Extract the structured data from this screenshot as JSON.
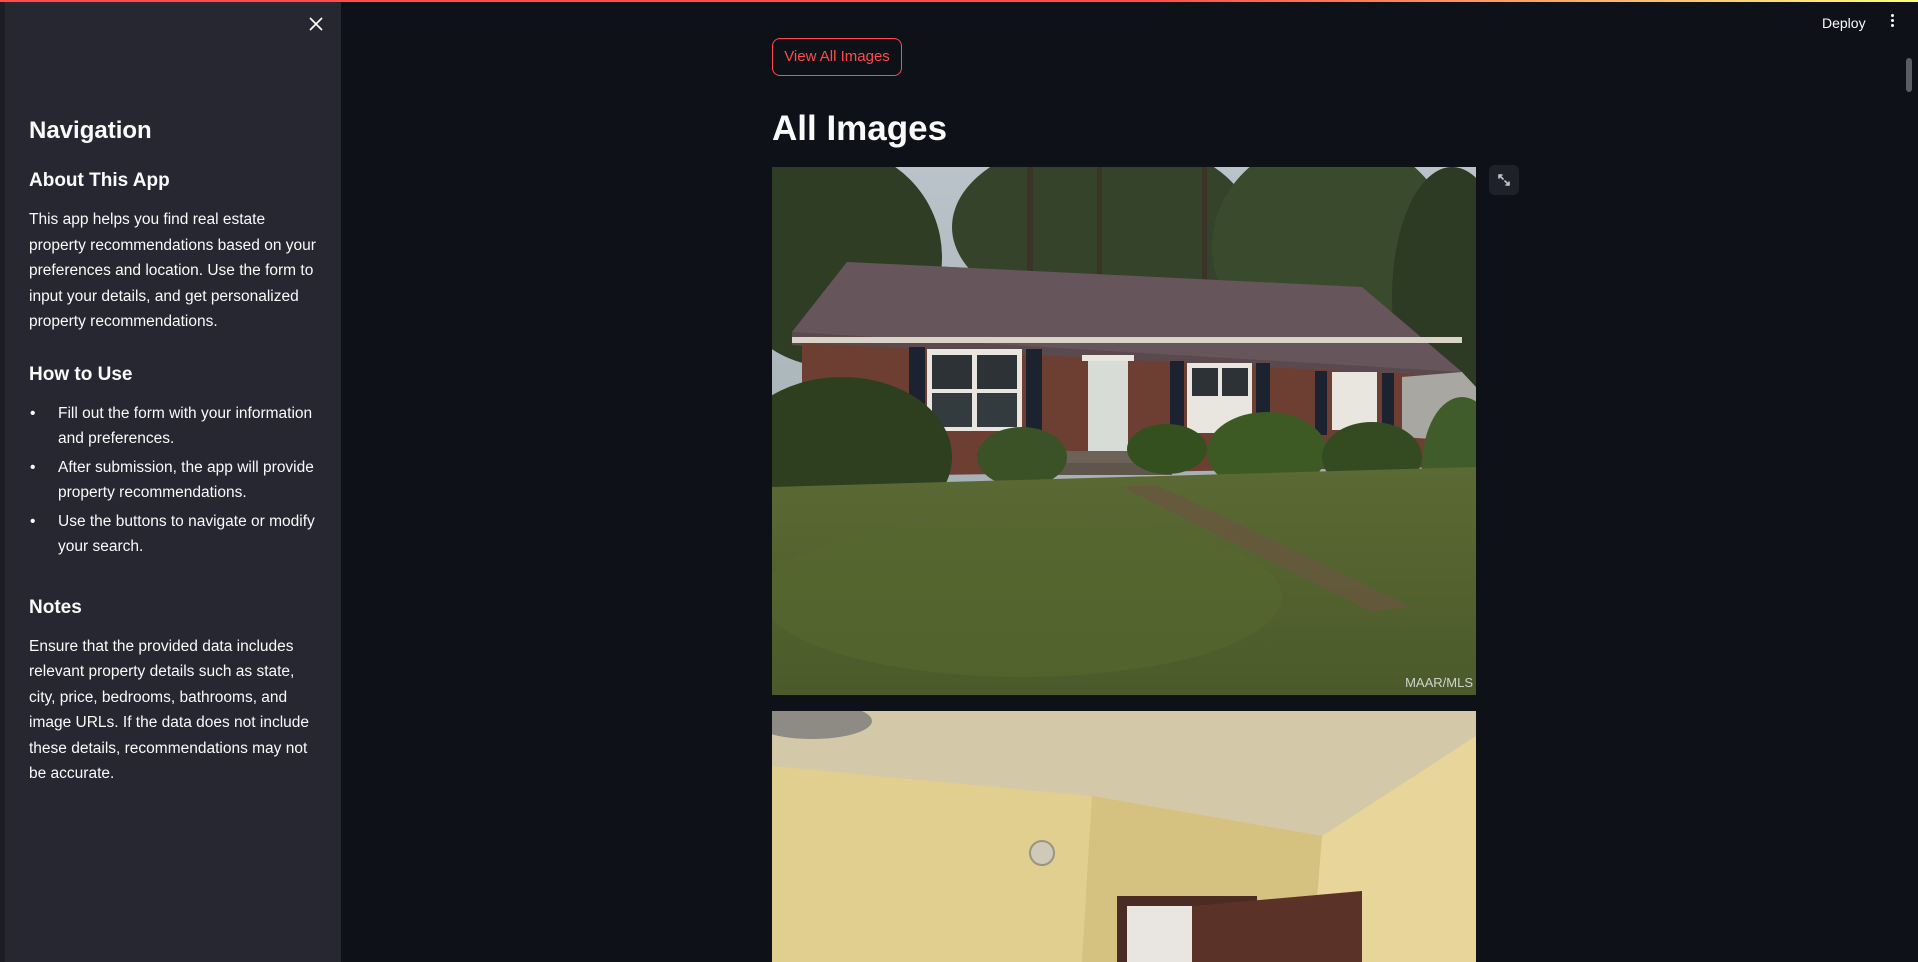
{
  "header": {
    "deploy_label": "Deploy",
    "menu_icon": "kebab-menu-icon"
  },
  "sidebar": {
    "title": "Navigation",
    "about": {
      "heading": "About This App",
      "text": "This app helps you find real estate property recommendations based on your preferences and location. Use the form to input your details, and get personalized property recommendations."
    },
    "how_to": {
      "heading": "How to Use",
      "items": [
        "Fill out the form with your information and preferences.",
        "After submission, the app will provide property recommendations.",
        "Use the buttons to navigate or modify your search."
      ]
    },
    "notes": {
      "heading": "Notes",
      "text": "Ensure that the provided data includes relevant property details such as state, city, price, bedrooms, bathrooms, and image URLs. If the data does not include these details, recommendations may not be accurate."
    }
  },
  "main": {
    "view_all_label": "View All Images",
    "title": "All Images",
    "image1_watermark": "MAAR/MLS"
  },
  "colors": {
    "accent": "#ff4b4b",
    "background": "#0e1117",
    "sidebar": "#262730",
    "text": "#fafafa"
  }
}
